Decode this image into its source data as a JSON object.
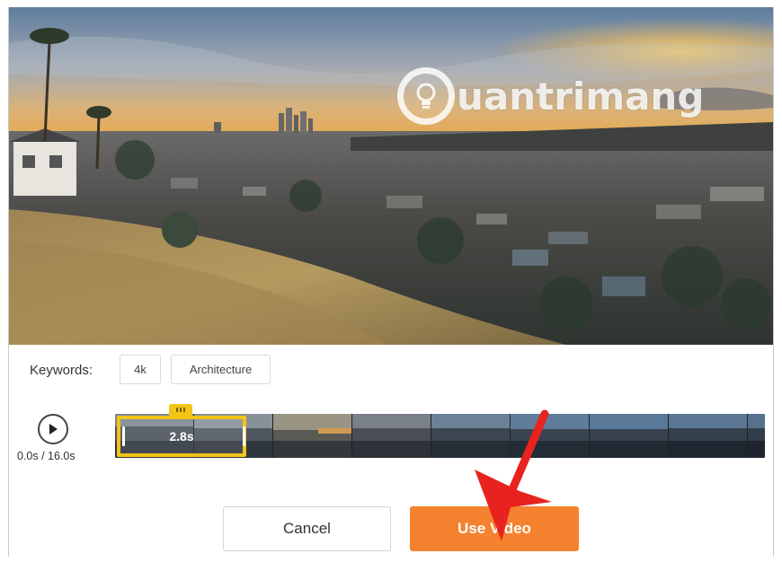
{
  "watermark": {
    "text": "uantrimang"
  },
  "keywords": {
    "label": "Keywords:",
    "tags": [
      "4k",
      "Architecture"
    ]
  },
  "player": {
    "play_icon": "play-icon",
    "time_readout": "0.0s / 16.0s",
    "selection_label": "2.8s"
  },
  "actions": {
    "cancel_label": "Cancel",
    "use_video_label": "Use Video"
  },
  "colors": {
    "accent_orange": "#f5822f",
    "selection_yellow": "#f2c318",
    "annotation_red": "#e8231f"
  }
}
